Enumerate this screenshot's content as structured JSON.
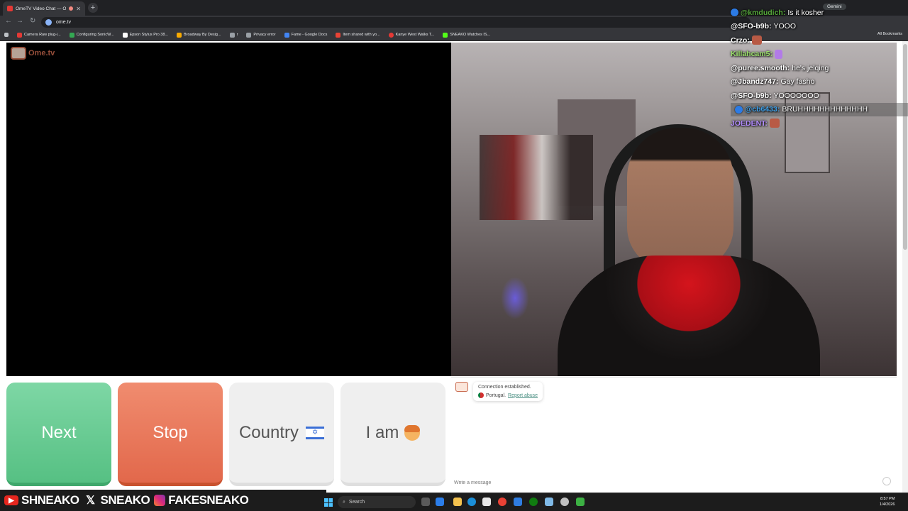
{
  "browser": {
    "tab_title": "OmeTV Video Chat — Ome",
    "url": "ome.tv",
    "bookmarks": [
      "Camera Raw plug-i...",
      "Configuring SonicW...",
      "Epson Stylus Pro 38...",
      "Broadway By Desig...",
      "r",
      "Privacy error",
      "Fame - Google Docs",
      "Item shared with yo...",
      "Kanye West Walks T...",
      "SNEAKO Watches IS..."
    ],
    "all_bookmarks": "All Bookmarks",
    "gemini": "Gemini"
  },
  "page": {
    "logo": "Ome.tv",
    "buttons": {
      "next": "Next",
      "stop": "Stop",
      "country": "Country",
      "iam": "I am"
    },
    "notice": {
      "line1": "Connection established.",
      "country": "Portugal.",
      "report": "Report abuse"
    },
    "message_placeholder": "Write a message"
  },
  "stream_chat": [
    {
      "user": "@kmdudich:",
      "text": "Is it kosher",
      "badge": true,
      "color": "#56a83a",
      "highlight": false
    },
    {
      "user": "@SFO-b9b:",
      "text": "YOOO",
      "badge": false,
      "color": "#ffffff",
      "highlight": false
    },
    {
      "user": "Crzo:",
      "text": "",
      "badge": false,
      "color": "#ffffff",
      "highlight": false,
      "emote": "brown"
    },
    {
      "user": "Killahcam5:",
      "text": "",
      "badge": false,
      "color": "#9be06b",
      "highlight": false,
      "emote": "feather"
    },
    {
      "user": "@puree.smooth:",
      "text": "he's jelqing",
      "badge": false,
      "color": "#ffffff",
      "highlight": false
    },
    {
      "user": "@Jbandz747:",
      "text": "Gay fasho",
      "badge": false,
      "color": "#ffffff",
      "highlight": false
    },
    {
      "user": "@SFO-b9b:",
      "text": "YOOOOOOO",
      "badge": false,
      "color": "#ffffff",
      "highlight": false
    },
    {
      "user": "@cb6433:",
      "text": "BRUHHHHHHHHHHHHH",
      "badge": true,
      "color": "#3fa0e8",
      "highlight": true
    },
    {
      "user": "JOEDENT:",
      "text": "",
      "badge": false,
      "color": "#b38cff",
      "highlight": false,
      "emote": "brown"
    }
  ],
  "stream_banner": {
    "youtube": "SHNEAKO",
    "x": "SNEAKO",
    "instagram": "FAKESNEAKO"
  },
  "taskbar": {
    "search": "Search",
    "time": "8:57 PM",
    "date": "1/4/2026"
  },
  "colors": {
    "next": "#6fcf98",
    "stop": "#ec7a5e",
    "neutral": "#efefef"
  }
}
